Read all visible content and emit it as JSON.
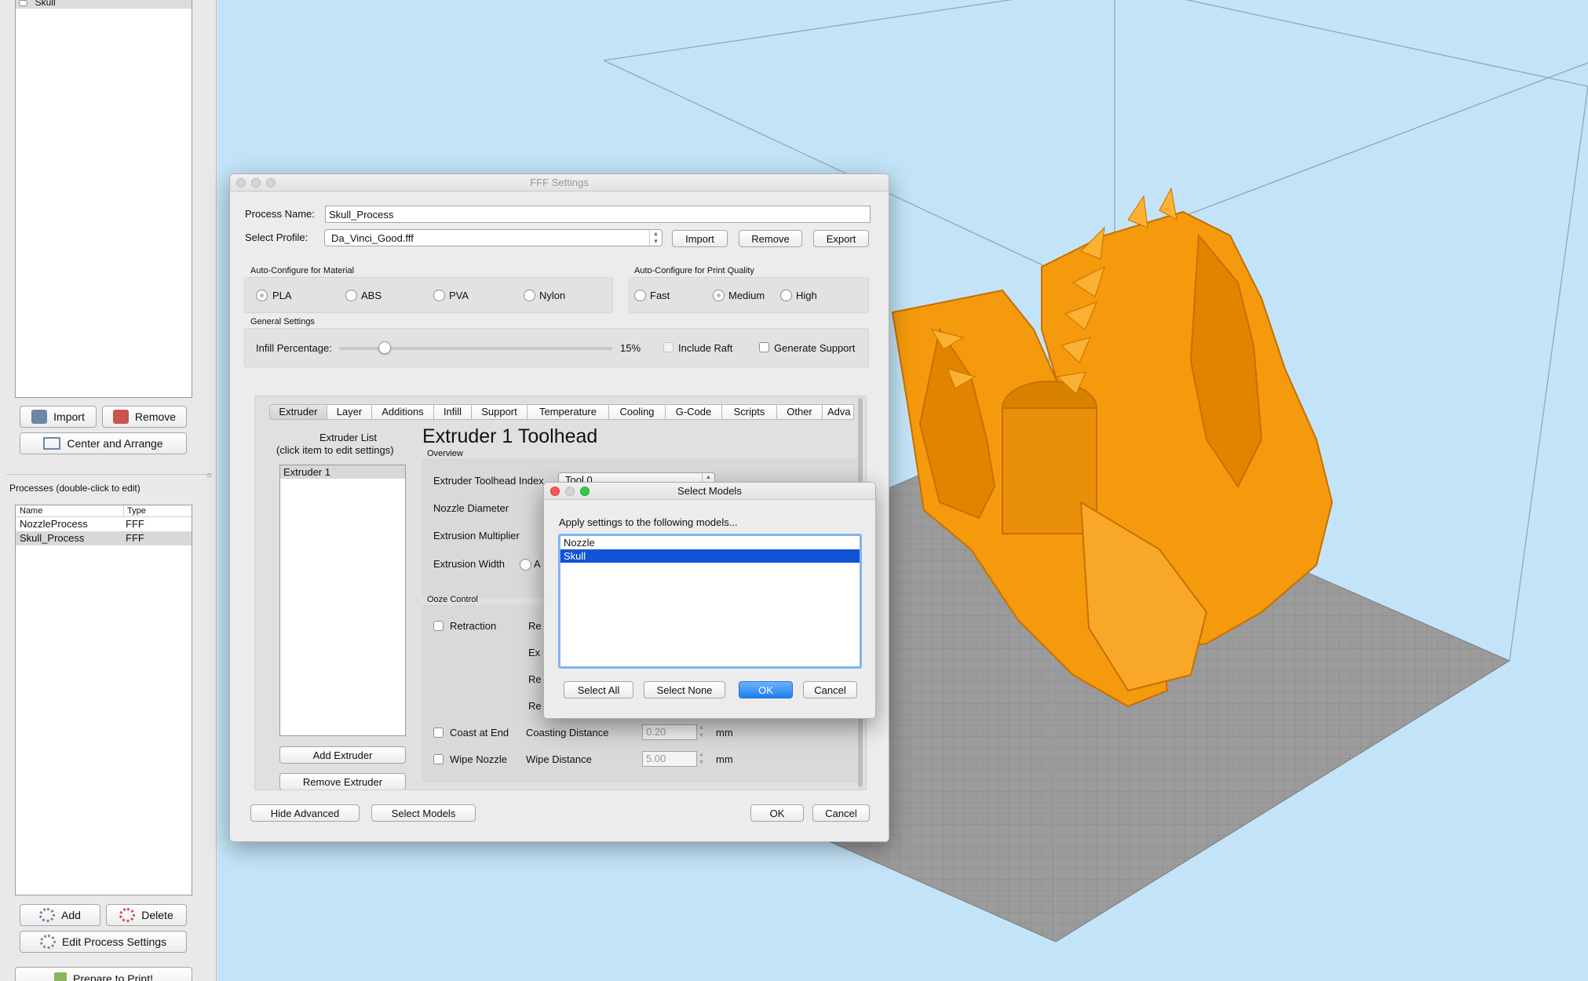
{
  "left_panel": {
    "models_list": [
      {
        "label": "Skull"
      }
    ],
    "import_label": "Import",
    "remove_label": "Remove",
    "center_arrange_label": "Center and Arrange",
    "processes_title": "Processes (double-click to edit)",
    "processes_columns": [
      "Name",
      "Type"
    ],
    "processes": [
      {
        "name": "NozzleProcess",
        "type": "FFF"
      },
      {
        "name": "Skull_Process",
        "type": "FFF"
      }
    ],
    "add_label": "Add",
    "delete_label": "Delete",
    "edit_process_label": "Edit Process Settings",
    "prepare_label": "Prepare to Print!"
  },
  "fff": {
    "title": "FFF Settings",
    "process_name_label": "Process Name:",
    "process_name_value": "Skull_Process",
    "select_profile_label": "Select Profile:",
    "profile_value": "Da_Vinci_Good.fff",
    "import_label": "Import",
    "remove_label": "Remove",
    "export_label": "Export",
    "material_title": "Auto-Configure for Material",
    "materials": [
      "PLA",
      "ABS",
      "PVA",
      "Nylon"
    ],
    "quality_title": "Auto-Configure for Print Quality",
    "qualities": [
      "Fast",
      "Medium",
      "High"
    ],
    "general_title": "General Settings",
    "infill_label": "Infill Percentage:",
    "infill_value": "15%",
    "infill_fraction": 0.15,
    "include_raft_label": "Include Raft",
    "generate_support_label": "Generate Support",
    "tabs": [
      "Extruder",
      "Layer",
      "Additions",
      "Infill",
      "Support",
      "Temperature",
      "Cooling",
      "G-Code",
      "Scripts",
      "Other",
      "Adva"
    ],
    "extruder_list_title": "Extruder List",
    "extruder_list_sub": "(click item to edit settings)",
    "extruders": [
      "Extruder 1"
    ],
    "add_extruder_label": "Add Extruder",
    "remove_extruder_label": "Remove Extruder",
    "toolhead_title": "Extruder 1 Toolhead",
    "overview_label": "Overview",
    "toolhead_index_label": "Extruder Toolhead Index",
    "toolhead_index_value": "Tool 0",
    "nozzle_diameter_label": "Nozzle Diameter",
    "extrusion_multiplier_label": "Extrusion Multiplier",
    "extrusion_width_label": "Extrusion Width",
    "extrusion_width_option": "A",
    "ooze_label": "Ooze Control",
    "retraction_label": "Retraction",
    "ooze_partial": [
      "Re",
      "Ex",
      "Re",
      "Re"
    ],
    "coast_label": "Coast at End",
    "coasting_distance_label": "Coasting Distance",
    "coasting_value": "0.20",
    "wipe_label": "Wipe Nozzle",
    "wipe_distance_label": "Wipe Distance",
    "wipe_value": "5.00",
    "unit_mm": "mm",
    "hide_advanced_label": "Hide Advanced",
    "select_models_label": "Select Models",
    "ok_label": "OK",
    "cancel_label": "Cancel"
  },
  "select_models": {
    "title": "Select Models",
    "prompt": "Apply settings to the following models...",
    "models": [
      {
        "name": "Nozzle",
        "selected": false
      },
      {
        "name": "Skull",
        "selected": true
      }
    ],
    "select_all_label": "Select All",
    "select_none_label": "Select None",
    "ok_label": "OK",
    "cancel_label": "Cancel"
  },
  "colors": {
    "viewport_bg": "#c3e4f8",
    "model_orange": "#f59a0c",
    "bed_grey": "#9b9b9b",
    "selection_blue": "#1153d6"
  }
}
